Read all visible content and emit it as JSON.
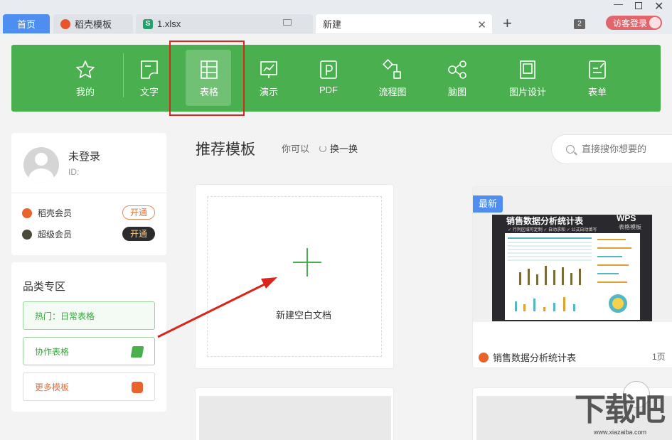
{
  "tabs": {
    "home": "首页",
    "tab1": "稻壳模板",
    "tab2": "1.xlsx",
    "tab3": "新建",
    "new_tab": "+",
    "window_count": "2",
    "guest_login": "访客登录"
  },
  "toolbar": {
    "items": [
      {
        "label": "我的",
        "icon": "star-icon"
      },
      {
        "label": "文字",
        "icon": "document-icon"
      },
      {
        "label": "表格",
        "icon": "spreadsheet-icon"
      },
      {
        "label": "演示",
        "icon": "presentation-icon"
      },
      {
        "label": "PDF",
        "icon": "pdf-icon"
      },
      {
        "label": "流程图",
        "icon": "flowchart-icon"
      },
      {
        "label": "脑图",
        "icon": "mindmap-icon"
      },
      {
        "label": "图片设计",
        "icon": "image-design-icon"
      },
      {
        "label": "表单",
        "icon": "form-icon"
      }
    ],
    "active_index": 2,
    "color": "#4ab04f"
  },
  "user": {
    "name": "未登录",
    "id_label": "ID:",
    "vip1_label": "稻壳会员",
    "vip1_btn": "开通",
    "vip2_label": "超级会员",
    "vip2_btn": "开通"
  },
  "category": {
    "title": "品类专区",
    "items": [
      "热门：日常表格",
      "协作表格",
      "更多模板"
    ]
  },
  "main": {
    "title": "推荐模板",
    "hint": "你可以",
    "refresh": "换一换",
    "search_placeholder": "直接搜你想要的",
    "blank_label": "新建空白文档",
    "template": {
      "badge": "最新",
      "sheet_title": "销售数据分析统计表",
      "wps": "WPS",
      "wps_sub": "表格模板",
      "sheet_sub": "✓ 行列区域可定制   ✓ 自动求和   ✓ 公式自动填写",
      "name": "销售数据分析统计表",
      "pages": "1页"
    }
  },
  "watermark": {
    "text": "下载吧",
    "url": "www.xiazaiba.com"
  }
}
